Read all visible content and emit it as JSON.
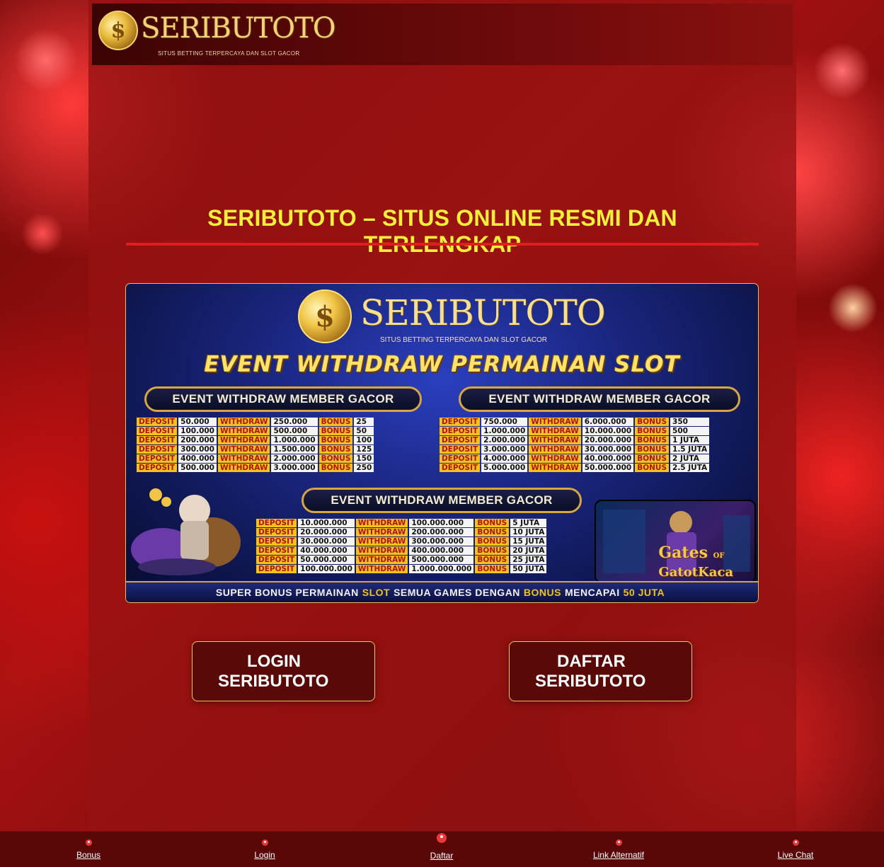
{
  "header": {
    "logo_mark": "$",
    "logo_text": "SERIBUTOTO",
    "logo_tagline": "SITUS BETTING TERPERCAYA DAN SLOT GACOR"
  },
  "main": {
    "headline": "SERIBUTOTO – SITUS ONLINE RESMI DAN TERLENGKAP"
  },
  "banner": {
    "logo_text": "SERIBUTOTO",
    "tagline": "SITUS BETTING TERPERCAYA DAN SLOT GACOR",
    "title": "EVENT WITHDRAW PERMAINAN SLOT",
    "ribbon_left": "EVENT WITHDRAW MEMBER GACOR",
    "ribbon_right": "EVENT WITHDRAW MEMBER GACOR",
    "ribbon_bottom": "EVENT WITHDRAW MEMBER GACOR",
    "labels": {
      "deposit": "DEPOSIT",
      "withdraw": "WITHDRAW",
      "bonus": "BONUS"
    },
    "table_left": [
      [
        "50.000",
        "250.000",
        "25"
      ],
      [
        "100.000",
        "500.000",
        "50"
      ],
      [
        "200.000",
        "1.000.000",
        "100"
      ],
      [
        "300.000",
        "1.500.000",
        "125"
      ],
      [
        "400.000",
        "2.000.000",
        "150"
      ],
      [
        "500.000",
        "3.000.000",
        "250"
      ]
    ],
    "table_right": [
      [
        "750.000",
        "6.000.000",
        "350"
      ],
      [
        "1.000.000",
        "10.000.000",
        "500"
      ],
      [
        "2.000.000",
        "20.000.000",
        "1 JUTA"
      ],
      [
        "3.000.000",
        "30.000.000",
        "1.5 JUTA"
      ],
      [
        "4.000.000",
        "40.000.000",
        "2 JUTA"
      ],
      [
        "5.000.000",
        "50.000.000",
        "2.5 JUTA"
      ]
    ],
    "table_bottom": [
      [
        "10.000.000",
        "100.000.000",
        "5 JUTA"
      ],
      [
        "20.000.000",
        "200.000.000",
        "10 JUTA"
      ],
      [
        "30.000.000",
        "300.000.000",
        "15 JUTA"
      ],
      [
        "40.000.000",
        "400.000.000",
        "20 JUTA"
      ],
      [
        "50.000.000",
        "500.000.000",
        "25 JUTA"
      ],
      [
        "100.000.000",
        "1.000.000.000",
        "50 JUTA"
      ]
    ],
    "game_title_1": "Gates",
    "game_title_2": "OF",
    "game_title_3": "GatotKaca",
    "footer": {
      "part1": "SUPER BONUS PERMAINAN",
      "hl1": "SLOT",
      "part2": "SEMUA GAMES DENGAN",
      "hl2": "BONUS",
      "part3": "MENCAPAI",
      "hl3": "50 JUTA"
    }
  },
  "buttons": {
    "login_line1": "LOGIN",
    "login_line2": "SERIBUTOTO",
    "daftar_line1": "DAFTAR",
    "daftar_line2": "SERIBUTOTO"
  },
  "bottom_nav": {
    "items": [
      {
        "label": "Bonus",
        "icon": "user-icon"
      },
      {
        "label": "Login",
        "icon": "user-icon"
      },
      {
        "label": "Daftar",
        "icon": "user-icon"
      },
      {
        "label": "Link Alternatif",
        "icon": "user-icon"
      },
      {
        "label": "Live Chat",
        "icon": "user-icon"
      }
    ]
  },
  "colors": {
    "headline": "#f4ef3a",
    "rule": "#e11d1d",
    "button_border": "#f0c85a",
    "nav_bg": "#5a0707"
  }
}
